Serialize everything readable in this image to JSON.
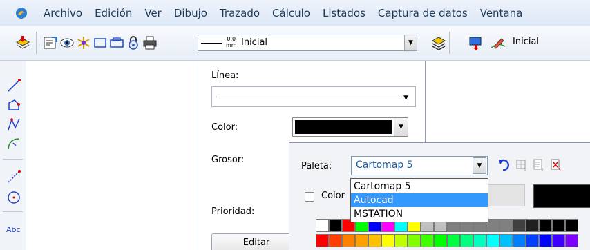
{
  "menu": {
    "items": [
      "Archivo",
      "Edición",
      "Ver",
      "Dibujo",
      "Trazado",
      "Cálculo",
      "Listados",
      "Captura de datos",
      "Ventana"
    ]
  },
  "toolbar": {
    "line_mm_top": "0.0",
    "line_mm_bottom": "mm",
    "line_combo_value": "Inicial",
    "right_combo_value": "Inicial"
  },
  "panel": {
    "linea_label": "Línea:",
    "color_label": "Color:",
    "grosor_label": "Grosor:",
    "prioridad_label": "Prioridad:",
    "editar_label": "Editar",
    "current_color": "#000000"
  },
  "popup": {
    "paleta_label": "Paleta:",
    "paleta_value": "Cartomap 5",
    "checkbox_label": "Color",
    "options": [
      "Cartomap 5",
      "Autocad",
      "MSTATION"
    ],
    "selected_option": "Autocad"
  },
  "palette_rows": [
    [
      "#ffffff",
      "#000000",
      "#ff0000",
      "#00ff00",
      "#0000ff",
      "#ff00ff",
      "#00ffff",
      "#ffff00",
      "#c0c0c0",
      "#c0c0c0",
      "#808080",
      "#808080",
      "#808080",
      "#808080",
      "#808080",
      "#404040",
      "#202020",
      "#000000",
      "#000000",
      "#000000"
    ],
    [
      "#ff0000",
      "#ff4000",
      "#ff8000",
      "#ffa000",
      "#ffc000",
      "#ffff00",
      "#c0ff00",
      "#80ff00",
      "#40ff00",
      "#00ff00",
      "#00ff40",
      "#00ff80",
      "#00ffc0",
      "#00ffff",
      "#00c0ff",
      "#0080ff",
      "#0040ff",
      "#0000ff",
      "#4000ff",
      "#8000ff"
    ]
  ]
}
